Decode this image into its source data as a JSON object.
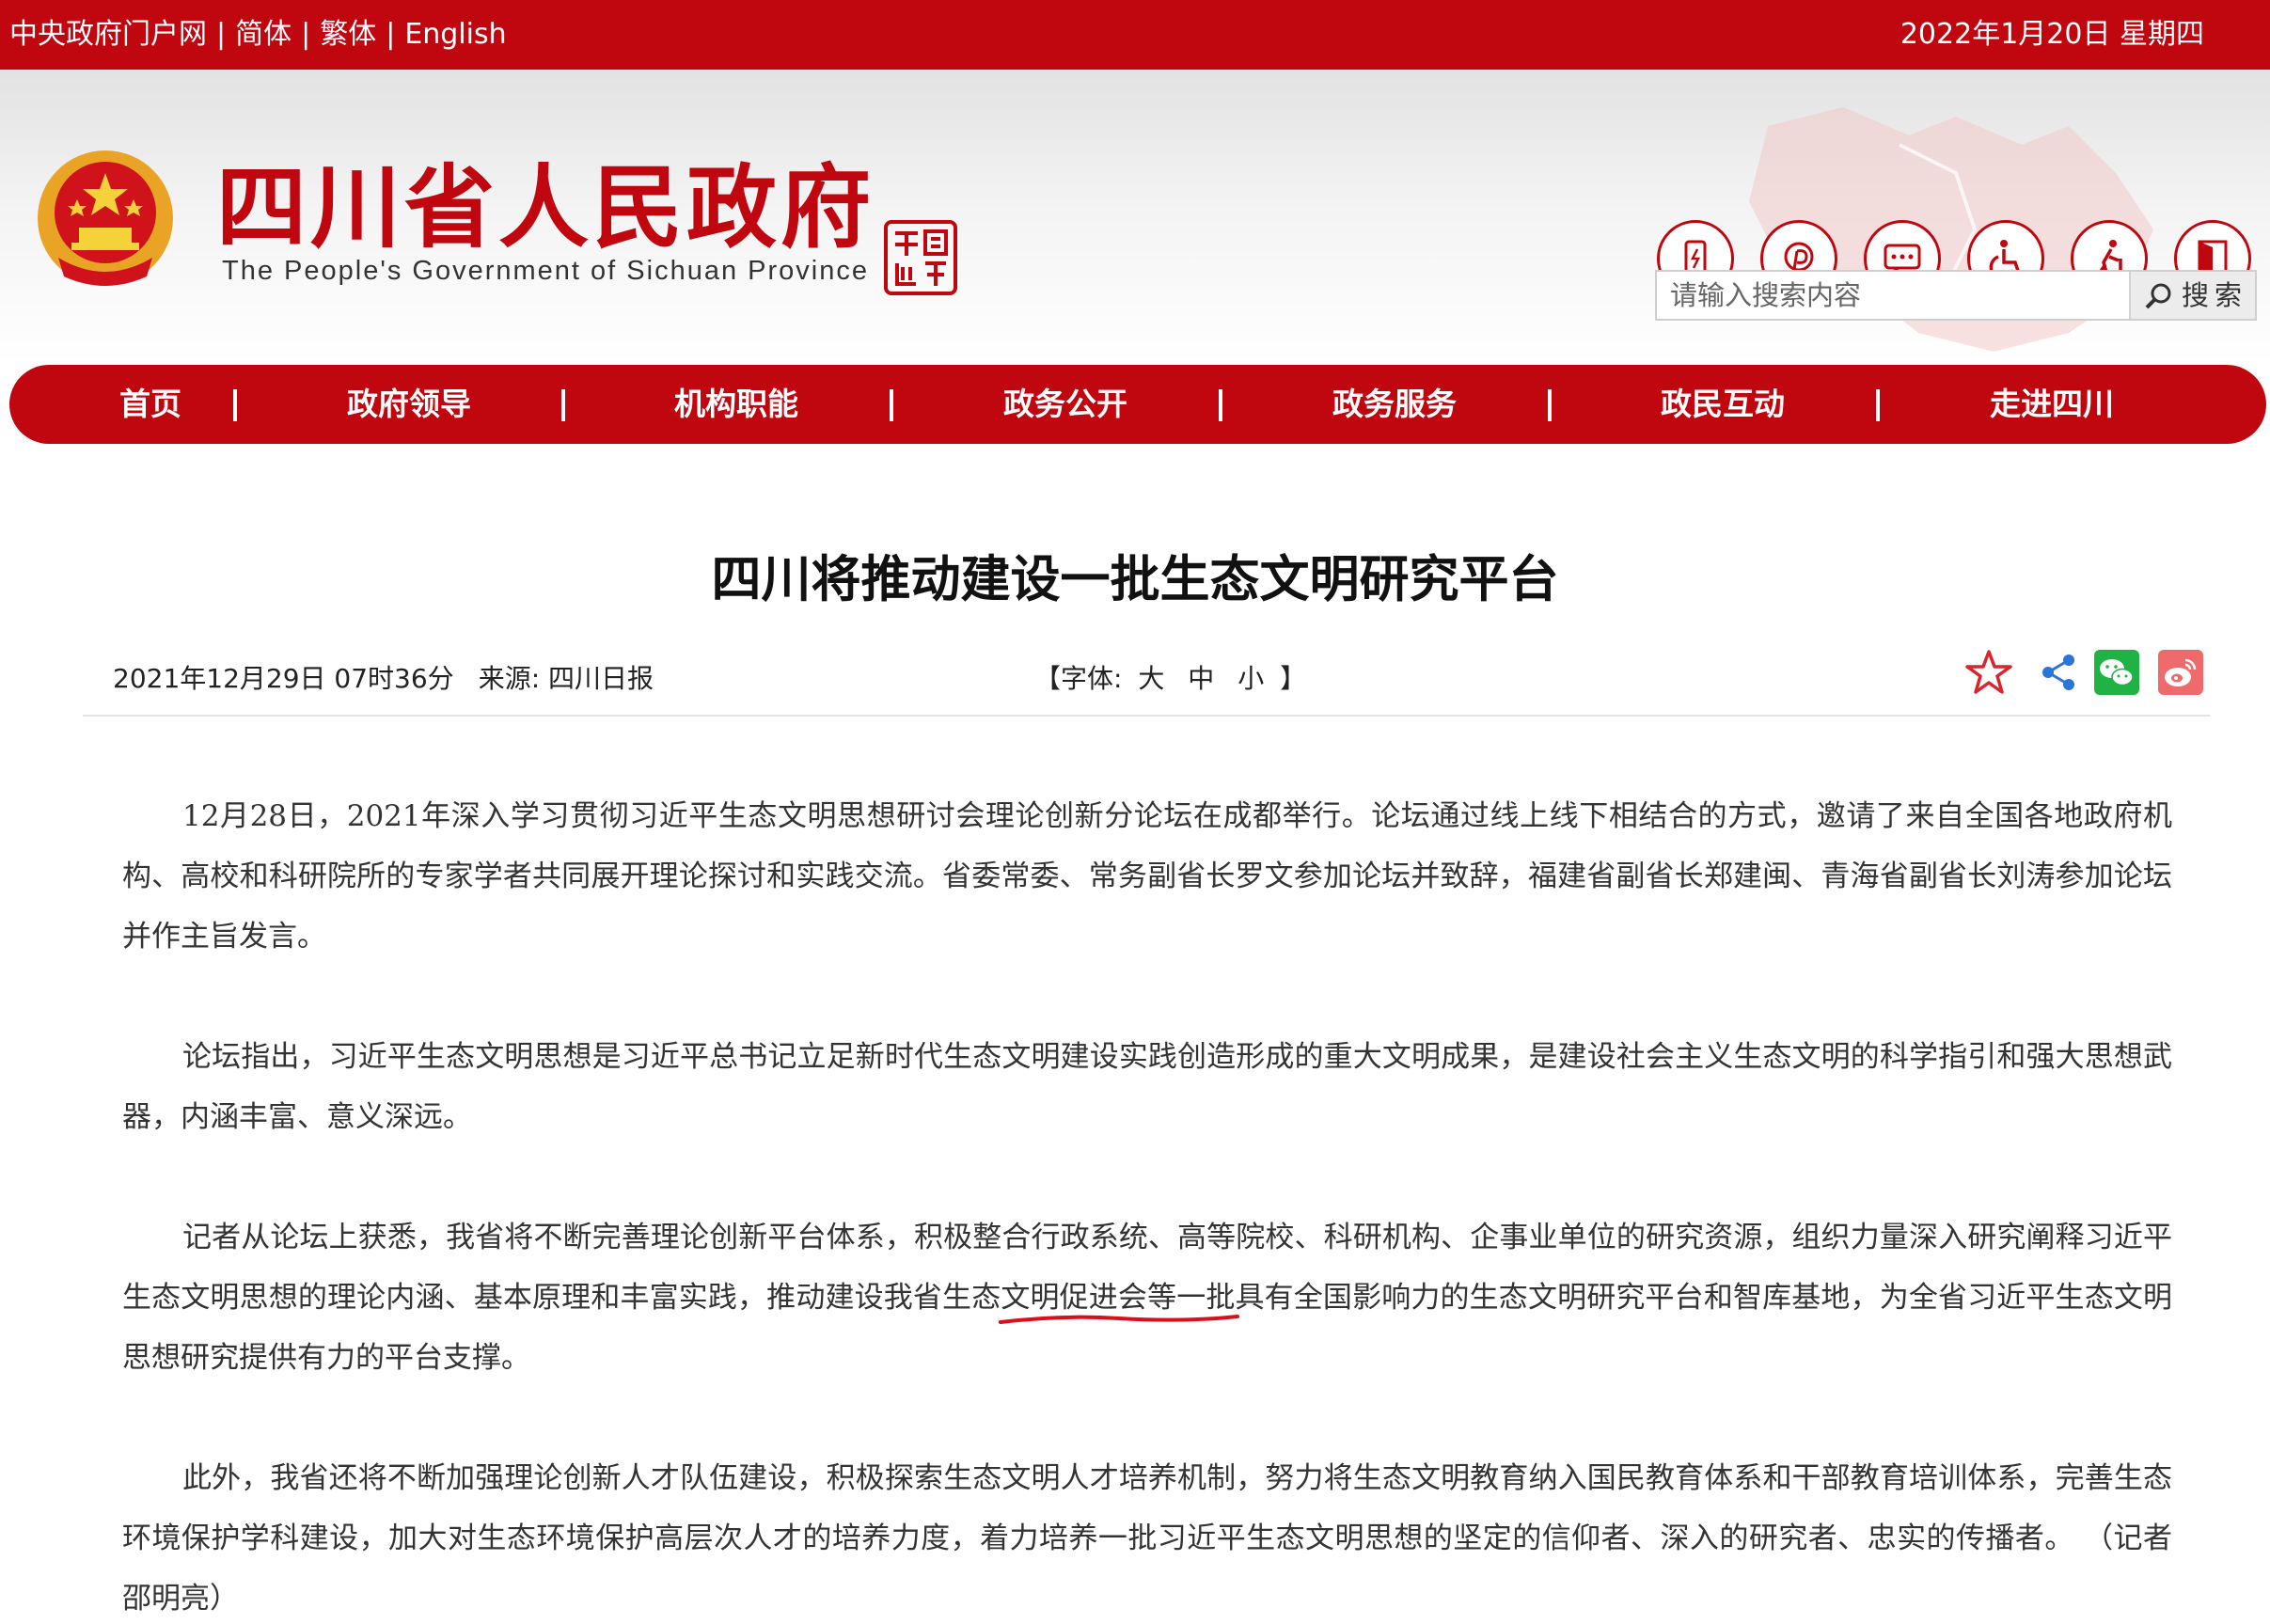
{
  "topbar": {
    "links": [
      "中央政府门户网",
      "简体",
      "繁体",
      "English"
    ],
    "separator": "|",
    "date": "2022年1月20日 星期四"
  },
  "header": {
    "title": "四川省人民政府",
    "subtitle": "The People's Government of Sichuan Province",
    "search_placeholder": "请输入搜索内容",
    "search_button": "搜索",
    "colors": {
      "brand": "#c0060f"
    },
    "tool_icons": [
      "mobile-icon",
      "weibo-style-icon",
      "message-icon",
      "accessibility-icon",
      "elderly-icon",
      "exit-icon"
    ]
  },
  "nav": {
    "items": [
      "首页",
      "政府领导",
      "机构职能",
      "政务公开",
      "政务服务",
      "政民互动",
      "走进四川"
    ],
    "separator": "|"
  },
  "article": {
    "title": "四川将推动建设一批生态文明研究平台",
    "datetime": "2021年12月29日 07时36分",
    "source": "来源: 四川日报",
    "font_size_label_open": "【字体:",
    "font_size_options": [
      "大",
      "中",
      "小"
    ],
    "font_size_label_close": "】",
    "share_icons": [
      "favorite-star-icon",
      "share-icon",
      "wechat-icon",
      "weibo-icon"
    ],
    "paragraphs": [
      "12月28日，2021年深入学习贯彻习近平生态文明思想研讨会理论创新分论坛在成都举行。论坛通过线上线下相结合的方式，邀请了来自全国各地政府机构、高校和科研院所的专家学者共同展开理论探讨和实践交流。省委常委、常务副省长罗文参加论坛并致辞，福建省副省长郑建闽、青海省副省长刘涛参加论坛并作主旨发言。",
      "论坛指出，习近平生态文明思想是习近平总书记立足新时代生态文明建设实践创造形成的重大文明成果，是建设社会主义生态文明的科学指引和强大思想武器，内涵丰富、意义深远。",
      "记者从论坛上获悉，我省将不断完善理论创新平台体系，积极整合行政系统、高等院校、科研机构、企事业单位的研究资源，组织力量深入研究阐释习近平生态文明思想的理论内涵、基本原理和丰富实践，推动建设我省生态文明促进会等一批具有全国影响力的生态文明研究平台和智库基地，为全省习近平生态文明思想研究提供有力的平台支撑。",
      "此外，我省还将不断加强理论创新人才队伍建设，积极探索生态文明人才培养机制，努力将生态文明教育纳入国民教育体系和干部教育培训体系，完善生态环境保护学科建设，加大对生态环境保护高层次人才的培养力度，着力培养一批习近平生态文明思想的坚定的信仰者、深入的研究者、忠实的传播者。 （记者 邵明亮）"
    ]
  }
}
